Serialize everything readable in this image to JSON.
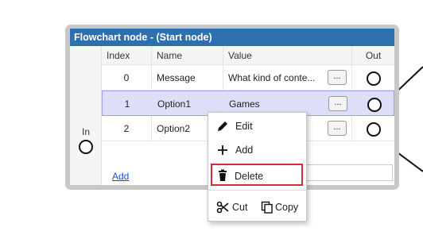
{
  "node": {
    "title": "Flowchart node - (Start node)",
    "in_label": "In",
    "columns": {
      "index": "Index",
      "name": "Name",
      "value": "Value",
      "out": "Out"
    },
    "rows": [
      {
        "index": "0",
        "name": "Message",
        "value": "What kind of conte...",
        "button": "..."
      },
      {
        "index": "1",
        "name": "Option1",
        "value": "Games",
        "button": "..."
      },
      {
        "index": "2",
        "name": "Option2",
        "value": "",
        "button": "..."
      }
    ],
    "selected_row": 1,
    "add_link": "Add"
  },
  "context_menu": {
    "edit": "Edit",
    "add": "Add",
    "delete": "Delete",
    "cut": "Cut",
    "copy": "Copy",
    "highlight_color": "#d62d3a"
  },
  "colors": {
    "title_bar": "#2e6fae",
    "selection": "#dcdff7"
  }
}
